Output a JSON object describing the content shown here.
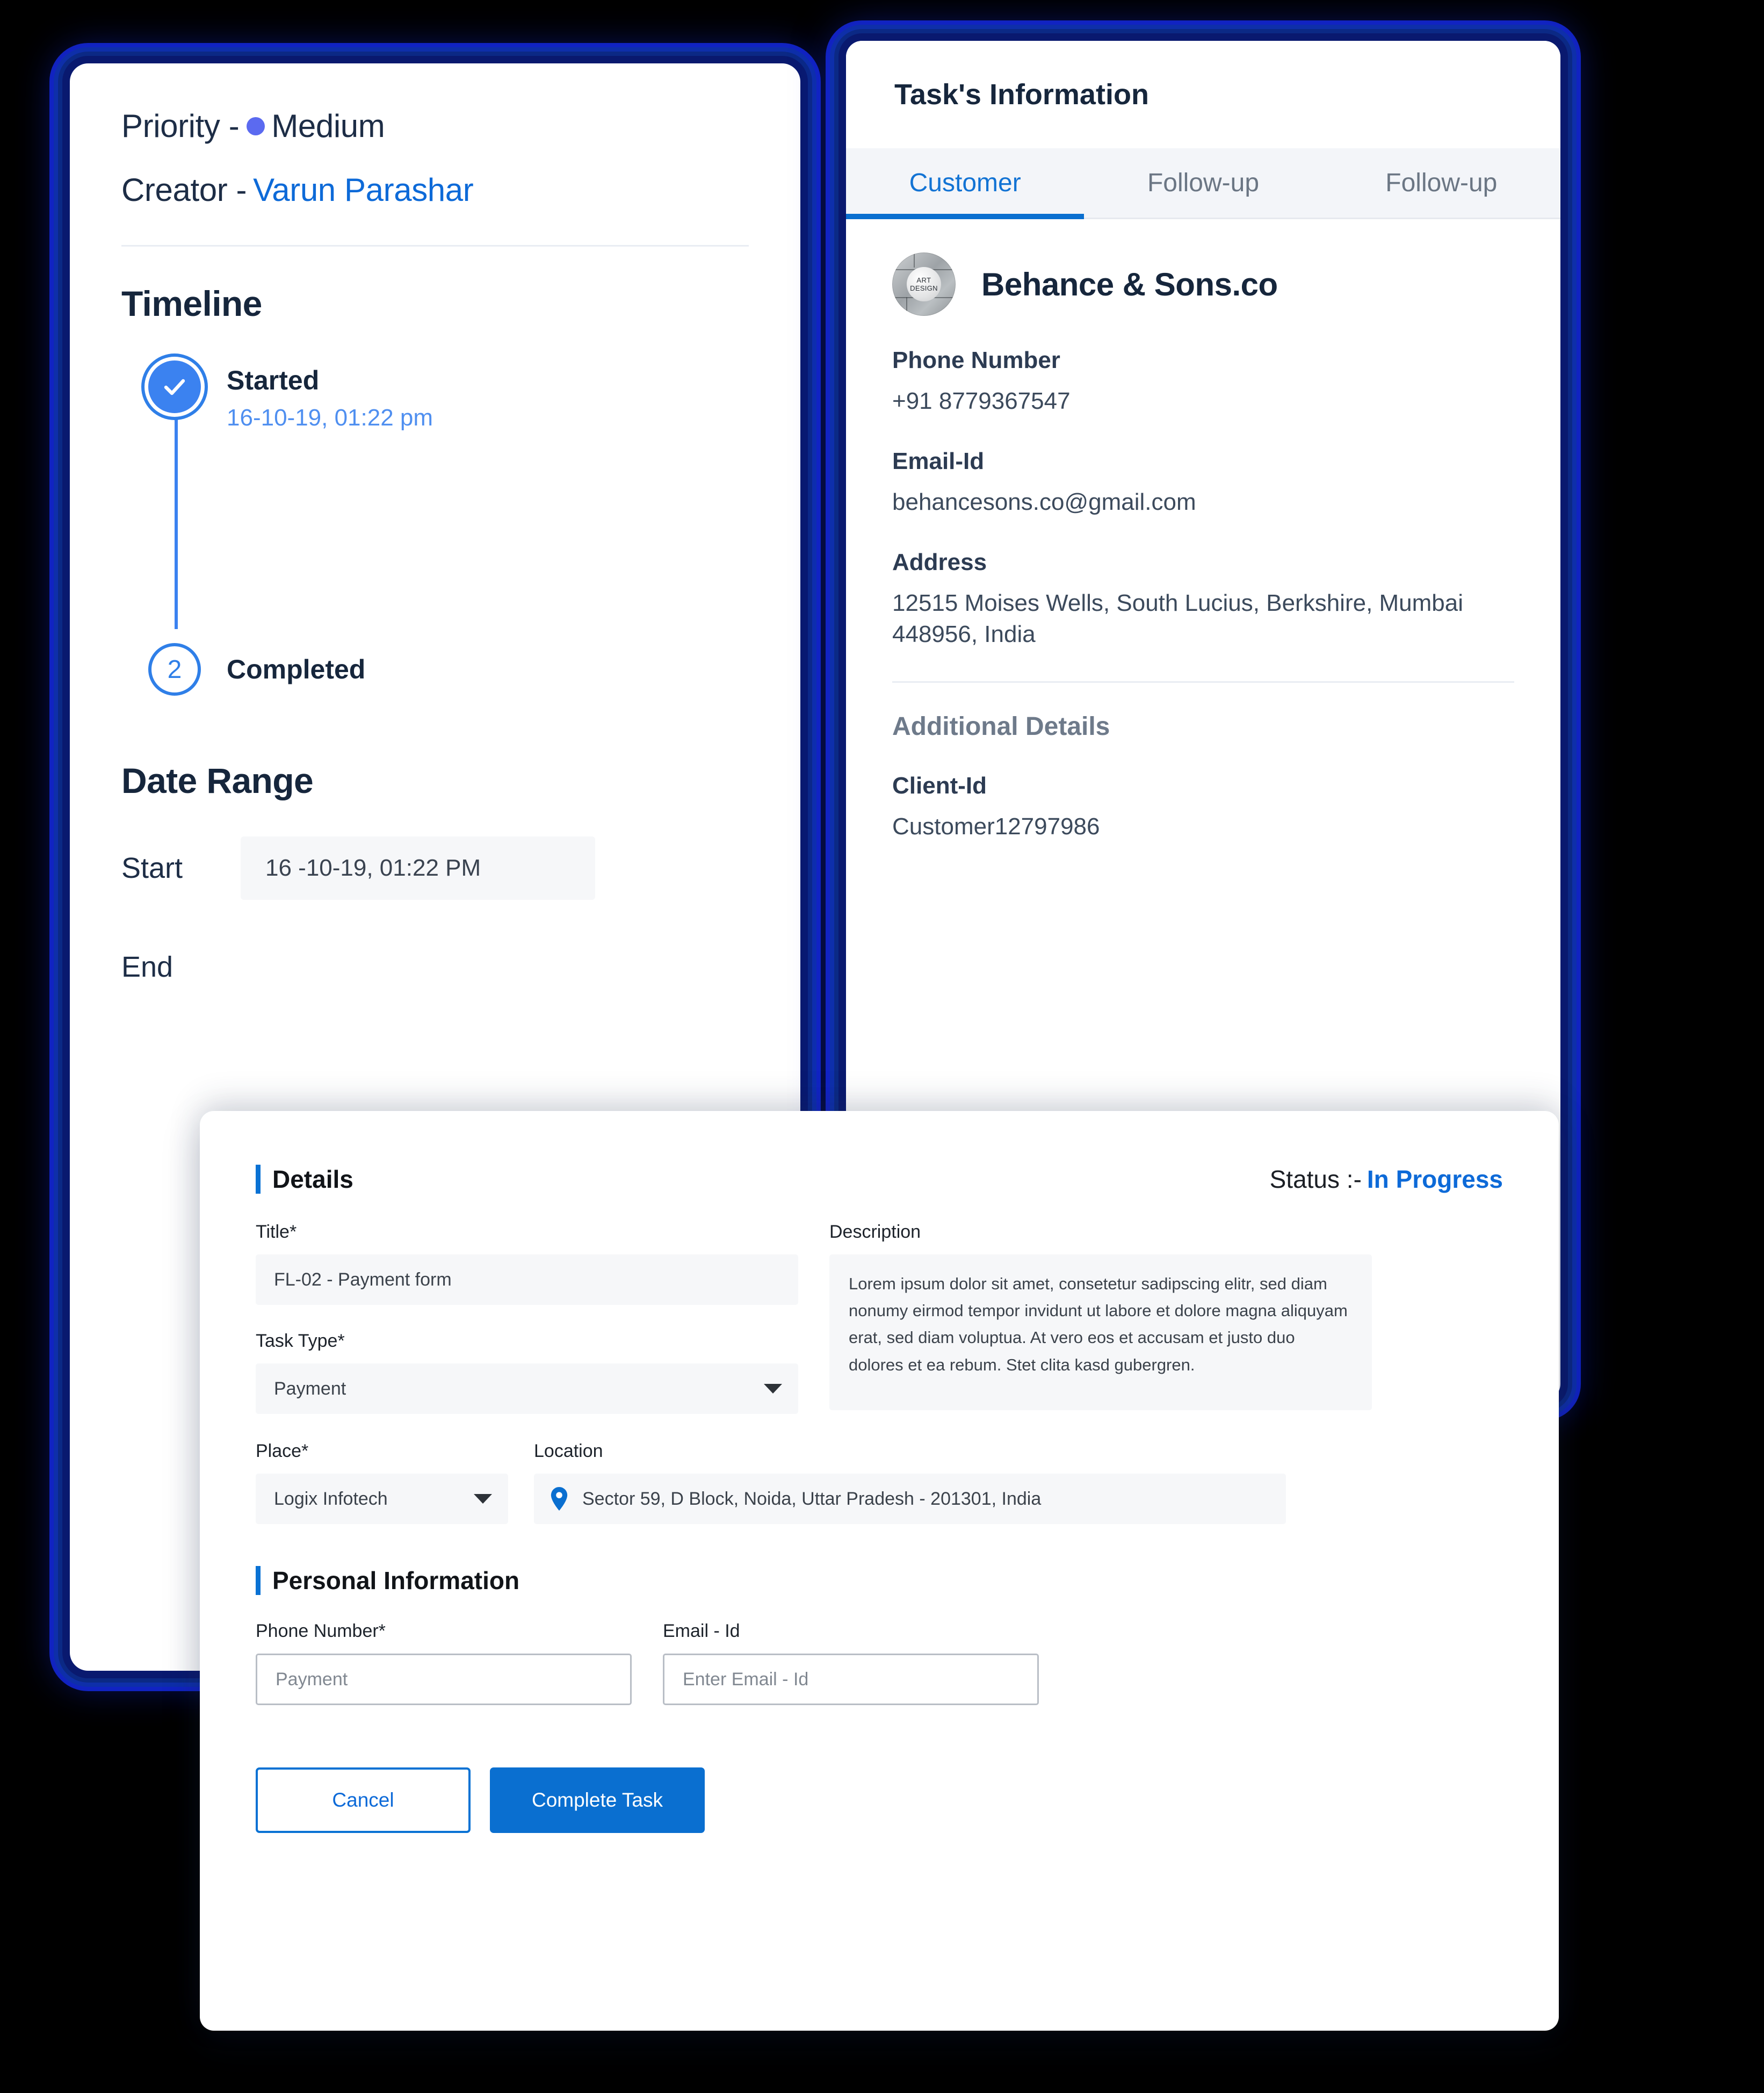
{
  "colors": {
    "accent_blue": "#0a6fd0",
    "link_blue": "#0d6ad8",
    "priority_dot": "#5b6af0",
    "dark_text": "#16263c",
    "muted_text": "#6e7a8a",
    "field_bg": "#f6f7f9",
    "page_bg": "#000000"
  },
  "left_panel": {
    "priority_label": "Priority -",
    "priority_value": "Medium",
    "creator_label": "Creator -",
    "creator_value": "Varun Parashar",
    "timeline_heading": "Timeline",
    "timeline": [
      {
        "label": "Started",
        "time": "16-10-19, 01:22 pm",
        "marker": "check-icon",
        "state": "done"
      },
      {
        "label": "Completed",
        "time": "",
        "marker": "2",
        "state": "pending"
      }
    ],
    "date_range_heading": "Date Range",
    "date_range": [
      {
        "label": "Start",
        "value": "16 -10-19, 01:22 PM"
      },
      {
        "label": "End",
        "value": ""
      }
    ]
  },
  "right_panel": {
    "title": "Task's Information",
    "tabs": [
      {
        "label": "Customer",
        "active": true
      },
      {
        "label": "Follow-up",
        "active": false
      },
      {
        "label": "Follow-up",
        "active": false
      }
    ],
    "customer": {
      "logo_line1": "ART",
      "logo_line2": "DESIGN",
      "name": "Behance & Sons.co",
      "fields": [
        {
          "label": "Phone Number",
          "value": "+91 8779367547"
        },
        {
          "label": "Email-Id",
          "value": "behancesons.co@gmail.com"
        },
        {
          "label": "Address",
          "value": "12515 Moises Wells, South Lucius, Berkshire, Mumbai 448956, India"
        }
      ]
    },
    "additional_details": {
      "heading": "Additional Details",
      "fields": [
        {
          "label": "Client-Id",
          "value": "Customer12797986"
        }
      ]
    }
  },
  "modal": {
    "details_heading": "Details",
    "status_label": "Status :-",
    "status_value": "In Progress",
    "title_field": {
      "label": "Title*",
      "value": "FL-02 - Payment form"
    },
    "task_type_field": {
      "label": "Task Type*",
      "value": "Payment"
    },
    "description_field": {
      "label": "Description",
      "value": "Lorem ipsum dolor sit amet, consetetur sadipscing elitr, sed diam nonumy eirmod tempor invidunt ut labore et dolore magna aliquyam erat, sed diam voluptua. At vero eos et accusam et justo duo dolores et ea rebum. Stet clita kasd gubergren."
    },
    "place_field": {
      "label": "Place*",
      "value": "Logix Infotech"
    },
    "location_field": {
      "label": "Location",
      "value": "Sector 59, D Block, Noida, Uttar Pradesh - 201301, India"
    },
    "personal_heading": "Personal Information",
    "phone_field": {
      "label": "Phone Number*",
      "placeholder": "Payment"
    },
    "email_field": {
      "label": "Email - Id",
      "placeholder": "Enter Email - Id"
    },
    "cancel_label": "Cancel",
    "complete_label": "Complete Task"
  }
}
